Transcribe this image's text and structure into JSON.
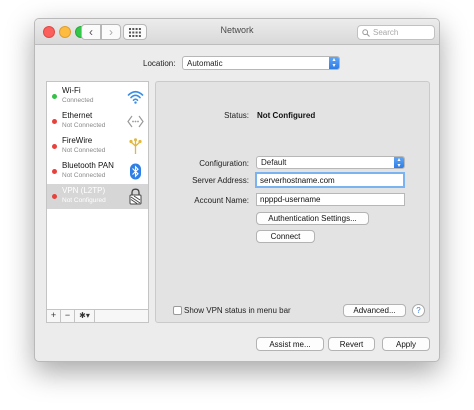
{
  "window": {
    "title": "Network"
  },
  "toolbar": {
    "search_placeholder": "Search"
  },
  "location": {
    "label": "Location:",
    "value": "Automatic"
  },
  "services": [
    {
      "name": "Wi-Fi",
      "status": "Connected",
      "dot_color": "#35c147",
      "icon": "wifi-icon"
    },
    {
      "name": "Ethernet",
      "status": "Not Connected",
      "dot_color": "#e8413c",
      "icon": "ethernet-icon"
    },
    {
      "name": "FireWire",
      "status": "Not Connected",
      "dot_color": "#e8413c",
      "icon": "firewire-icon"
    },
    {
      "name": "Bluetooth PAN",
      "status": "Not Connected",
      "dot_color": "#e8413c",
      "icon": "bluetooth-icon"
    },
    {
      "name": "VPN (L2TP)",
      "status": "Not Configured",
      "dot_color": "#e8413c",
      "icon": "vpn-lock-icon",
      "selected": true
    }
  ],
  "sidebar_tools": {
    "add": "+",
    "remove": "−",
    "action": "✱▾"
  },
  "detail": {
    "status_label": "Status:",
    "status_value": "Not Configured",
    "configuration_label": "Configuration:",
    "configuration_value": "Default",
    "server_label": "Server Address:",
    "server_value": "serverhostname.com",
    "account_label": "Account Name:",
    "account_value": "npppd-username",
    "auth_button": "Authentication Settings...",
    "connect_button": "Connect",
    "show_vpn_label": "Show VPN status in menu bar",
    "show_vpn_checked": false,
    "advanced_button": "Advanced...",
    "help": "?"
  },
  "footer": {
    "assist_button": "Assist me...",
    "revert_button": "Revert",
    "apply_button": "Apply"
  },
  "colors": {
    "accent": "#2d7ce8",
    "focus_ring": "#7ab3f2",
    "selected_row": "#d6d6d6"
  }
}
